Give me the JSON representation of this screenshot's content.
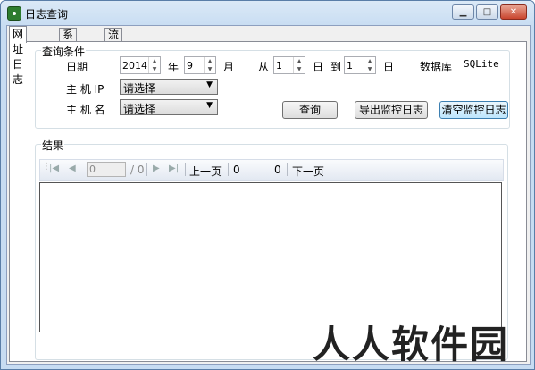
{
  "window": {
    "title": "日志查询",
    "min_icon": "minimize-icon",
    "max_icon": "maximize-icon",
    "close_icon": "close-icon"
  },
  "tabs": [
    {
      "label": "网址日志",
      "active": true
    },
    {
      "label": "系统日志",
      "active": false
    },
    {
      "label": "流量日志",
      "active": false
    }
  ],
  "conditions": {
    "label": "查询条件",
    "date_label": "日期",
    "year": "2014",
    "year_unit": "年",
    "month": "9",
    "month_unit": "月",
    "from_label": "从",
    "day_from": "1",
    "day_unit1": "日",
    "to_label": "到",
    "day_to": "1",
    "day_unit2": "日",
    "db_label": "数据库",
    "db_value": "SQLite",
    "host_ip_label": "主 机 IP",
    "host_ip_value": "请选择",
    "host_name_label": "主 机 名",
    "host_name_value": "请选择",
    "query_button": "查询",
    "export_button": "导出监控日志",
    "clear_button": "清空监控日志"
  },
  "results": {
    "label": "结果",
    "page_input": "0",
    "page_total": "/ 0",
    "prev_label": "上一页",
    "current_value": "0",
    "count_value": "0",
    "next_label": "下一页"
  },
  "watermark": "人人软件园"
}
